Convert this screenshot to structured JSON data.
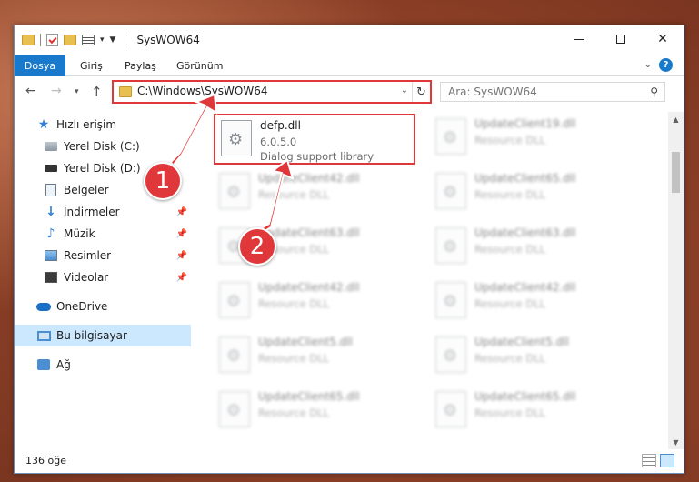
{
  "window": {
    "title": "SysWOW64",
    "buttons": {
      "minimize": "—",
      "maximize": "☐",
      "close": "✕"
    }
  },
  "ribbon": {
    "tabs": [
      "Dosya",
      "Giriş",
      "Paylaş",
      "Görünüm"
    ],
    "help": "?",
    "collapse": "⌄"
  },
  "nav": {
    "address": "C:\\Windows\\SysWOW64",
    "search_placeholder": "Ara: SysWOW64",
    "refresh": "↻",
    "up": "↑",
    "back": "←",
    "forward": "→"
  },
  "sidebar": {
    "items": [
      {
        "label": "Hızlı erişim",
        "icon": "star-icon"
      },
      {
        "label": "Yerel Disk (C:)",
        "icon": "disk-icon"
      },
      {
        "label": "Yerel Disk (D:)",
        "icon": "disk-icon"
      },
      {
        "label": "Belgeler",
        "icon": "document-icon"
      },
      {
        "label": "İndirmeler",
        "icon": "download-icon"
      },
      {
        "label": "Müzik",
        "icon": "music-icon"
      },
      {
        "label": "Resimler",
        "icon": "pictures-icon"
      },
      {
        "label": "Videolar",
        "icon": "video-icon"
      },
      {
        "label": "OneDrive",
        "icon": "cloud-icon"
      },
      {
        "label": "Bu bilgisayar",
        "icon": "computer-icon"
      },
      {
        "label": "Ağ",
        "icon": "network-icon"
      }
    ]
  },
  "files": [
    {
      "name": "defp.dll",
      "line1": "6.0.5.0",
      "line2": "Dialog support library"
    },
    {
      "name": "UpdateClient19.dll",
      "line1": "Resource DLL"
    },
    {
      "name": "UpdateClient42.dll",
      "line1": "Resource DLL"
    },
    {
      "name": "UpdateClient65.dll",
      "line1": "Resource DLL"
    },
    {
      "name": "UpdateClient63.dll",
      "line1": "Resource DLL"
    },
    {
      "name": "UpdateClient63.dll",
      "line1": "Resource DLL"
    },
    {
      "name": "UpdateClient42.dll",
      "line1": "Resource DLL"
    },
    {
      "name": "UpdateClient42.dll",
      "line1": "Resource DLL"
    },
    {
      "name": "UpdateClient5.dll",
      "line1": "Resource DLL"
    },
    {
      "name": "UpdateClient5.dll",
      "line1": "Resource DLL"
    },
    {
      "name": "UpdateClient65.dll",
      "line1": "Resource DLL"
    },
    {
      "name": "UpdateClient65.dll",
      "line1": "Resource DLL"
    }
  ],
  "status": {
    "count": "136 öğe"
  },
  "annotations": {
    "badge1": "1",
    "badge2": "2",
    "color": "#e0383a"
  }
}
